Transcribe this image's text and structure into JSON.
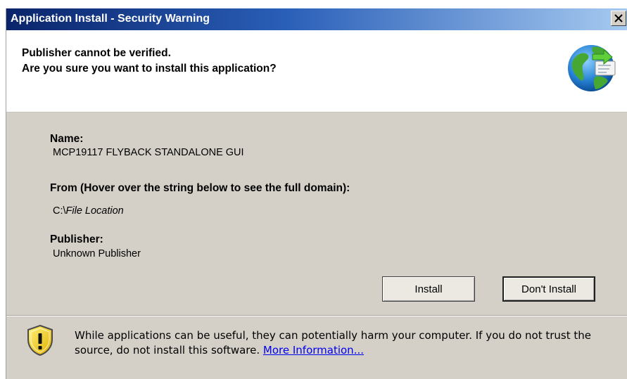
{
  "window": {
    "title": "Application Install - Security Warning",
    "close_label": "X"
  },
  "header": {
    "line1": "Publisher cannot be verified.",
    "line2": "Are you sure you want to install this application?",
    "icon": "globe-install-icon"
  },
  "details": {
    "name_label": "Name:",
    "name_value": "MCP19117 FLYBACK STANDALONE GUI",
    "from_label": "From (Hover over the string below to see the full domain):",
    "from_prefix": "C:\\",
    "from_value": "File Location",
    "publisher_label": "Publisher:",
    "publisher_value": "Unknown Publisher"
  },
  "buttons": {
    "install": "Install",
    "dont_install": "Don't Install"
  },
  "warning": {
    "icon": "shield-warning-icon",
    "text": "While applications can be useful, they can potentially harm your computer. If you do not trust the source, do not install this software. ",
    "link": "More Information..."
  },
  "colors": {
    "titlebar_start": "#0a246a",
    "titlebar_end": "#a6caf0",
    "dialog_bg": "#d4d0c8",
    "link": "#0000ee"
  }
}
